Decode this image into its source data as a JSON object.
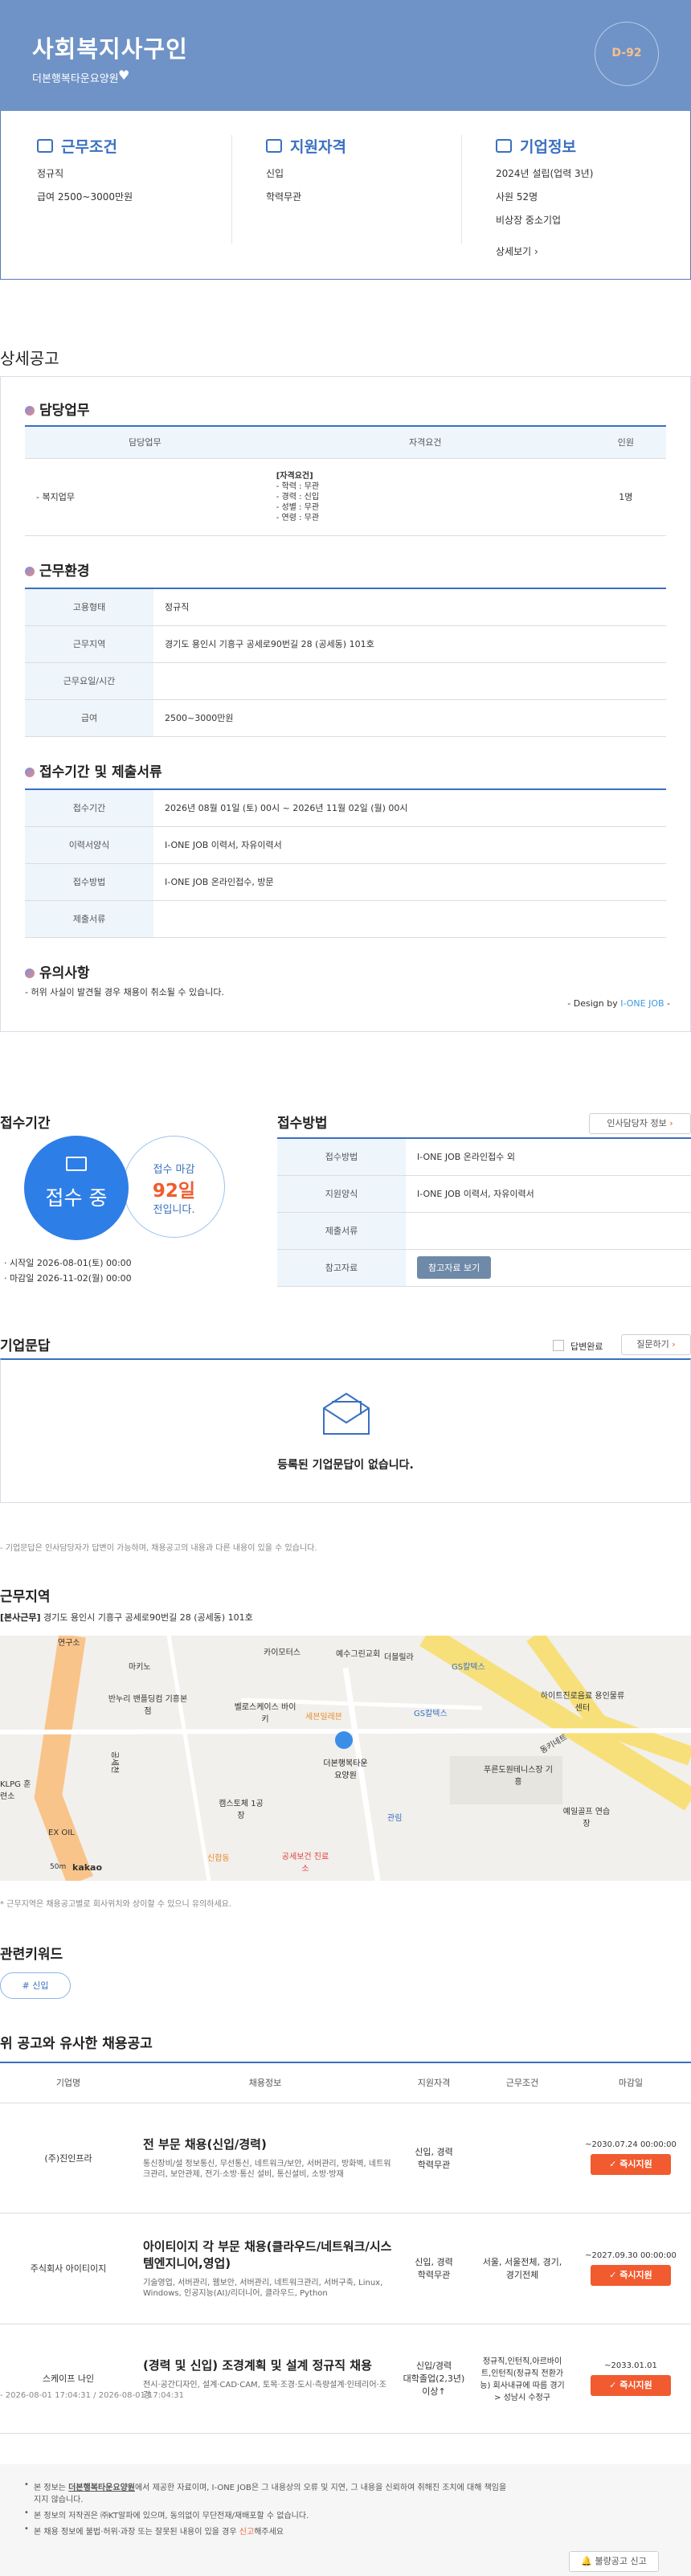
{
  "hero": {
    "title": "사회복지사구인",
    "company": "더본행복타운요양원",
    "dday": "D-92"
  },
  "summary": {
    "conditions": {
      "heading": "근무조건",
      "lines": [
        "정규직",
        "급여 2500~3000만원"
      ]
    },
    "qualification": {
      "heading": "지원자격",
      "lines": [
        "신입",
        "학력무관"
      ]
    },
    "company": {
      "heading": "기업정보",
      "lines": [
        "2024년 설립(업력 3년)",
        "사원 52명",
        "비상장 중소기업"
      ],
      "more": "상세보기 ›"
    }
  },
  "detail": {
    "heading": "상세공고",
    "duty": {
      "heading": "담당업무",
      "cols": [
        "담당업무",
        "자격요건",
        "인원"
      ],
      "task": "- 복지업무",
      "req_title": "[자격요건]",
      "reqs": [
        "- 학력 : 무관",
        "- 경력 : 신입",
        "- 성별 : 무관",
        "- 연령 : 무관"
      ],
      "count": "1명"
    },
    "env": {
      "heading": "근무환경",
      "rows": [
        {
          "label": "고용형태",
          "value": "정규직"
        },
        {
          "label": "근무지역",
          "value": "경기도 용인시 기흥구 공세로90번길 28 (공세동) 101호"
        },
        {
          "label": "근무요일/시간",
          "value": ""
        },
        {
          "label": "급여",
          "value": "2500~3000만원"
        }
      ]
    },
    "period": {
      "heading": "접수기간 및 제출서류",
      "rows": [
        {
          "label": "접수기간",
          "value": "2026년 08월 01일 (토) 00시 ~ 2026년 11월 02일 (월) 00시"
        },
        {
          "label": "이력서양식",
          "value": "I-ONE JOB 이력서, 자유이력서"
        },
        {
          "label": "접수방법",
          "value": "I-ONE JOB 온라인접수, 방문"
        },
        {
          "label": "제출서류",
          "value": ""
        }
      ]
    },
    "notice": {
      "heading": "유의사항",
      "text": "- 허위 사실이 발견될 경우 채용이 취소될 수 있습니다.",
      "design_prefix": "- Design by ",
      "design_brand": "I-ONE JOB",
      "design_suffix": " -"
    }
  },
  "apply": {
    "heading": "접수기간",
    "status": "접수 중",
    "deadline_label": "접수 마감",
    "days": "92일",
    "days_suffix": "전입니다.",
    "start": "· 시작일 2026-08-01(토) 00:00",
    "end": "· 마감일 2026-11-02(월) 00:00",
    "method_heading": "접수방법",
    "manager_btn": "인사담당자 정보",
    "rows": [
      {
        "label": "접수방법",
        "value": "I-ONE JOB 온라인접수 외"
      },
      {
        "label": "지원양식",
        "value": "I-ONE JOB 이력서, 자유이력서"
      },
      {
        "label": "제출서류",
        "value": ""
      },
      {
        "label": "참고자료",
        "value": ""
      }
    ],
    "ref_btn": "참고자료 보기"
  },
  "qa": {
    "heading": "기업문답",
    "answered": "답변완료",
    "ask_btn": "질문하기",
    "empty": "등록된 기업문답이 없습니다.",
    "note": "- 기업문답은 인사담당자가 답변이 가능하며, 채용공고의 내용과 다른 내용이 있을 수 있습니다."
  },
  "location": {
    "heading": "근무지역",
    "tag": "[본사근무]",
    "address": "경기도 용인시 기흥구 공세로90번길 28 (공세동) 101호",
    "note": "* 근무지역은 채용공고별로 회사위치와 상이할 수 있으니 유의하세요.",
    "map_labels": [
      "연구소",
      "마키노",
      "카이모터스",
      "예수그린교회",
      "더블릴라",
      "GS칼텍스",
      "반누리 밴플딩컴 기흥본점",
      "벨로스케이스 바이키",
      "세븐일레븐",
      "GS칼텍스",
      "하이트진로음료 용인물류센터",
      "동키네트",
      "더본행복타운 요양원",
      "푸른도원테니스장 기흥",
      "KLPG 훈련소",
      "캠스토체 1공장",
      "관림",
      "예일골프 연습장",
      "EX OIL",
      "신합동",
      "공세보건 진료소",
      "공세천",
      "50m",
      "kakao"
    ]
  },
  "keywords": {
    "heading": "관련키워드",
    "items": [
      "# 신입"
    ]
  },
  "similar": {
    "heading": "위 공고와 유사한 채용공고",
    "cols": [
      "기업명",
      "채용정보",
      "지원자격",
      "근무조건",
      "마감일"
    ],
    "rows": [
      {
        "company": "(주)진인프라",
        "title": "전 부문 채용(신입/경력)",
        "desc": "통신장비/설 정보통신, 무선통신, 네트워크/보안, 서버관리, 방화벽, 네트워크관리, 보안관제, 전기·소방·통신 설비, 통신설비, 소방·방재",
        "qual": "신입, 경력\n학력무관",
        "cond": "",
        "deadline": "~2030.07.24 00:00:00",
        "btn": "✓ 즉시지원"
      },
      {
        "company": "주식회사 아이티이지",
        "title": "아이티이지 각 부문 채용(클라우드/네트워크/시스템엔지니어,영업)",
        "desc": "기술영업, 서버관리, 웹보안, 서버관리, 네트워크관리, 서버구축, Linux, Windows, 인공지능(AI)/리더니어, 클라우드, Python",
        "qual": "신입, 경력\n학력무관",
        "cond": "서울, 서울전체, 경기, 경기전체",
        "deadline": "~2027.09.30 00:00:00",
        "btn": "✓ 즉시지원"
      },
      {
        "company": "스케이프 나인",
        "title": "(경력 및 신입) 조경계획 및 설계 정규직 채용",
        "desc": "전시·공간디자인, 설계·CAD·CAM, 토목·조경·도시·측량설계·인테리어·조경",
        "qual": "신입/경력\n대학졸업(2,3년)\n이상↑",
        "cond": "정규직,인턴직,아르바이트,인턴직(정규직 전환가능) 회사내규에 따름 경기> 성남시 수정구",
        "deadline": "~2033.01.01",
        "btn": "✓ 즉시지원"
      }
    ]
  },
  "dates": "- 2026-08-01 17:04:31 / 2026-08-01 17:04:31",
  "footer": {
    "n1a": "본 정보는 ",
    "n1b": "더본행복타운요양원",
    "n1c": "에서 제공한 자료이며, I-ONE JOB은 그 내용상의 오류 및 지연, 그 내용을 신뢰하여 취해진 조치에 대해 책임을 지지 않습니다.",
    "n2": "본 정보의 저작권은 ㈜KT알파에 있으며, 동의없이 무단전재/재배포할 수 없습니다.",
    "n3a": "본 채용 정보에 불법·허위·과장 또는 잘못된 내용이 있을 경우 ",
    "n3b": "신고",
    "n3c": "해주세요",
    "report": "불량공고 신고"
  }
}
